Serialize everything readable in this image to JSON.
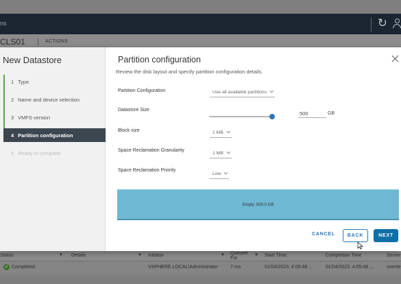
{
  "app": {
    "object_name": "CLS01",
    "actions_label": "ACTIONS"
  },
  "wizard": {
    "title": "New Datastore",
    "steps": [
      {
        "num": "1",
        "label": "Type",
        "state": "done"
      },
      {
        "num": "2",
        "label": "Name and device selection",
        "state": "done"
      },
      {
        "num": "3",
        "label": "VMFS version",
        "state": "done"
      },
      {
        "num": "4",
        "label": "Partition configuration",
        "state": "active"
      },
      {
        "num": "5",
        "label": "Ready to complete",
        "state": "disabled"
      }
    ]
  },
  "page": {
    "title": "Partition configuration",
    "subtitle": "Review the disk layout and specify partition configuration details."
  },
  "form": {
    "partition_configuration": {
      "label": "Partition Configuration",
      "value": "Use all available partitions"
    },
    "datastore_size": {
      "label": "Datastore Size",
      "value": "500",
      "unit": "GB",
      "slider_fraction": 0.97
    },
    "block_size": {
      "label": "Block size",
      "value": "1 MB"
    },
    "space_reclamation_granularity": {
      "label": "Space Reclamation Granularity",
      "value": "1 MB"
    },
    "space_reclamation_priority": {
      "label": "Space Reclamation Priority",
      "value": "Low"
    }
  },
  "disk_layout": {
    "label": "Empty: 500.0 GB",
    "color": "#6fb8d3"
  },
  "buttons": {
    "cancel": "CANCEL",
    "back": "BACK",
    "next": "NEXT"
  },
  "task_table": {
    "columns": [
      "Status",
      "Details",
      "Initiator",
      "Queued For",
      "Start Time",
      "Completion Time",
      "Server"
    ],
    "rows": [
      {
        "status": "Completed",
        "details": "",
        "initiator": "VSPHERE.LOCAL\\Administrator",
        "queued_for": "7 ms",
        "start_time": "01/04/2023, 4:05:48 ...",
        "completion_time": "01/04/2023, 4:05:48 ...",
        "server": "vcente"
      }
    ]
  },
  "colors": {
    "accent": "#2a76b1",
    "active_step": "#3c4650",
    "done_step": "#5aa14a"
  },
  "icons": [
    "refresh-icon",
    "user-icon",
    "close-icon",
    "chevron-down-icon",
    "check-circle-icon",
    "filter-icon"
  ]
}
